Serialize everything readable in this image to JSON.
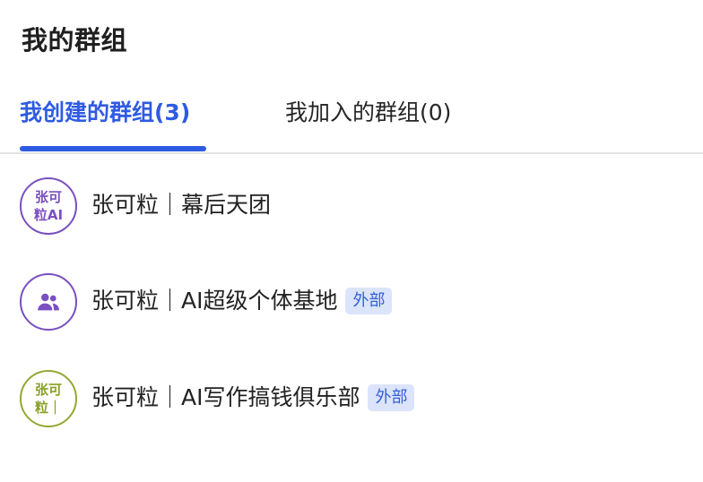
{
  "header": {
    "title": "我的群组"
  },
  "tabs": [
    {
      "label": "我创建的群组(3)",
      "active": true
    },
    {
      "label": "我加入的群组(0)",
      "active": false
    }
  ],
  "colors": {
    "accent": "#2f5be3",
    "badge_text": "#3561d9",
    "badge_bg": "#dbe4fb",
    "avatar_purple": "#7a4fc0",
    "avatar_green": "#8aa126"
  },
  "groups": [
    {
      "name": "张可粒｜幕后天团",
      "avatar": {
        "type": "text",
        "text": "张可粒AI",
        "color": "purple"
      },
      "badge": ""
    },
    {
      "name": "张可粒｜AI超级个体基地",
      "avatar": {
        "type": "icon",
        "icon": "people-group-icon",
        "color": "purple"
      },
      "badge": "外部"
    },
    {
      "name": "张可粒｜AI写作搞钱俱乐部",
      "avatar": {
        "type": "text",
        "text": "张可粒｜",
        "color": "green"
      },
      "badge": "外部"
    }
  ]
}
